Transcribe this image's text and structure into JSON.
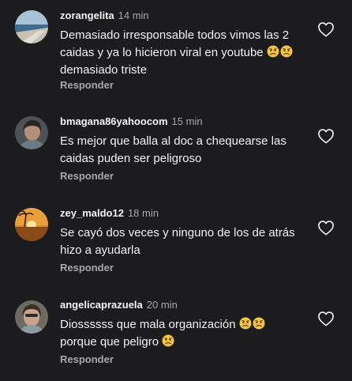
{
  "comments": [
    {
      "username": "zorangelita",
      "time": "14 min",
      "text_segments": [
        "Demasiado irresponsable todos vimos las 2 caidas y ya lo hicieron viral en youtube ",
        "",
        " demasiado triste"
      ],
      "reply_label": "Responder",
      "avatar": "beach-photo"
    },
    {
      "username": "bmagana86yahoocom",
      "time": "15 min",
      "text_segments": [
        "Es mejor que balla al doc a chequearse las caidas puden ser peligroso"
      ],
      "reply_label": "Responder",
      "avatar": "person-photo"
    },
    {
      "username": "zey_maldo12",
      "time": "18 min",
      "text_segments": [
        "Se cayó dos veces y ninguno de los de atrás hizo a ayudarla"
      ],
      "reply_label": "Responder",
      "avatar": "sunset-photo"
    },
    {
      "username": "angelicaprazuela",
      "time": "20 min",
      "text_segments": [
        "Diossssss que mala organización ",
        "",
        " porque que peligro "
      ],
      "reply_label": "Responder",
      "avatar": "person-photo"
    }
  ],
  "icons": {
    "like": "heart-outline-icon",
    "emoji": "sad-face-emoji"
  },
  "colors": {
    "background": "#1c1c1e",
    "text": "#f2f2f2",
    "muted": "#a8a8a8",
    "emoji": "#f4c542"
  }
}
